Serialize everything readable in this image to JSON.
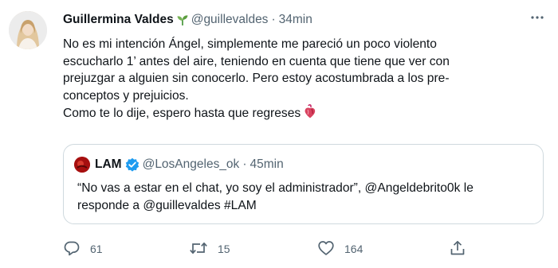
{
  "tweet": {
    "author": {
      "display_name": "Guillermina Valdes",
      "name_emoji": "seedling",
      "handle": "@guillevaldes",
      "separator": "·",
      "time": "34min"
    },
    "text_lines": [
      "No es mi intención Ángel, simplemente me pareció un poco violento",
      "escucharlo 1’ antes del aire, teniendo en cuenta que tiene que ver con",
      "prejuzgar a alguien sin conocerlo. Pero estoy acostumbrada a los pre-",
      "conceptos y prejuicios.",
      "Como te lo dije, espero hasta que regreses"
    ],
    "text_emoji": "anatomical-heart",
    "quoted": {
      "display_name": "LAM",
      "handle": "@LosAngeles_ok",
      "separator": "·",
      "time": "45min",
      "text_lines": [
        "“No vas a estar en el chat, yo soy el administrador”, @Angeldebrito0k le",
        "responde a @guillevaldes #LAM"
      ]
    },
    "actions": {
      "replies": "61",
      "retweets": "15",
      "likes": "164"
    },
    "icons": {
      "more": "more-icon",
      "reply": "reply-icon",
      "retweet": "retweet-icon",
      "like": "heart-icon",
      "share": "share-icon",
      "verified": "verified-badge-icon"
    },
    "colors": {
      "text": "#0f1419",
      "secondary": "#536471",
      "border": "#cfd9de",
      "verified": "#1d9bf0",
      "quote_avatar": "#b30d0d"
    }
  }
}
